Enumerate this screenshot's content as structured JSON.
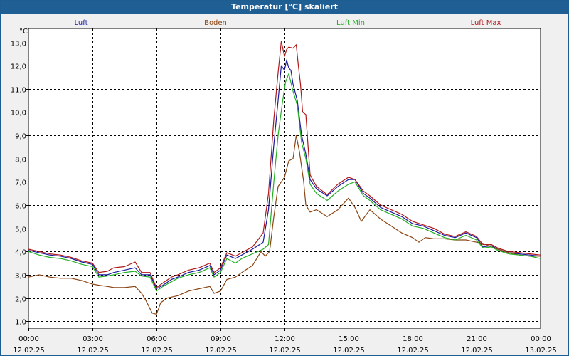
{
  "window": {
    "title": "Temperatur [°C] skaliert"
  },
  "colors": {
    "background": "#f0f0f0",
    "titlebar": "#1f5f94",
    "plot_background": "#ffffff",
    "grid": "#000000"
  },
  "chart_data": {
    "type": "line",
    "title": "Temperatur [°C] skaliert",
    "ylabel": "°C",
    "xlabel": "",
    "ylim": [
      0.7,
      13.6
    ],
    "xlim": [
      0,
      24
    ],
    "grid": true,
    "legend_placement": "top",
    "y_ticks": [
      "1,0",
      "2,0",
      "3,0",
      "4,0",
      "5,0",
      "6,0",
      "7,0",
      "8,0",
      "9,0",
      "10,0",
      "11,0",
      "12,0",
      "13,0"
    ],
    "x_ticks": [
      {
        "time": "00:00",
        "date": "12.02.25"
      },
      {
        "time": "03:00",
        "date": "12.02.25"
      },
      {
        "time": "06:00",
        "date": "12.02.25"
      },
      {
        "time": "09:00",
        "date": "12.02.25"
      },
      {
        "time": "12:00",
        "date": "12.02.25"
      },
      {
        "time": "15:00",
        "date": "12.02.25"
      },
      {
        "time": "18:00",
        "date": "12.02.25"
      },
      {
        "time": "21:00",
        "date": "12.02.25"
      },
      {
        "time": "00:00",
        "date": "13.02.25"
      }
    ],
    "series": [
      {
        "name": "Luft",
        "color": "#1a1aa0",
        "points": [
          [
            0,
            4.05
          ],
          [
            0.5,
            3.95
          ],
          [
            1,
            3.85
          ],
          [
            1.5,
            3.8
          ],
          [
            2,
            3.7
          ],
          [
            2.5,
            3.55
          ],
          [
            3,
            3.45
          ],
          [
            3.3,
            3.0
          ],
          [
            3.7,
            3.0
          ],
          [
            4,
            3.1
          ],
          [
            4.5,
            3.2
          ],
          [
            5,
            3.3
          ],
          [
            5.3,
            3.0
          ],
          [
            5.7,
            3.0
          ],
          [
            6,
            2.4
          ],
          [
            6.3,
            2.55
          ],
          [
            6.7,
            2.8
          ],
          [
            7,
            2.9
          ],
          [
            7.5,
            3.1
          ],
          [
            8,
            3.2
          ],
          [
            8.5,
            3.4
          ],
          [
            8.7,
            3.0
          ],
          [
            9,
            3.2
          ],
          [
            9.3,
            3.85
          ],
          [
            9.7,
            3.7
          ],
          [
            10,
            3.85
          ],
          [
            10.5,
            4.1
          ],
          [
            11,
            4.4
          ],
          [
            11.25,
            5.8
          ],
          [
            11.5,
            8.6
          ],
          [
            11.7,
            10.5
          ],
          [
            11.85,
            12.0
          ],
          [
            12,
            11.8
          ],
          [
            12.1,
            12.25
          ],
          [
            12.2,
            11.9
          ],
          [
            12.3,
            11.8
          ],
          [
            12.4,
            11.2
          ],
          [
            12.6,
            10.5
          ],
          [
            12.8,
            9.0
          ],
          [
            13,
            8.2
          ],
          [
            13.2,
            7.1
          ],
          [
            13.5,
            6.7
          ],
          [
            14,
            6.4
          ],
          [
            14.5,
            6.8
          ],
          [
            15,
            7.1
          ],
          [
            15.3,
            7.1
          ],
          [
            15.7,
            6.5
          ],
          [
            16,
            6.3
          ],
          [
            16.5,
            5.9
          ],
          [
            17,
            5.7
          ],
          [
            17.5,
            5.5
          ],
          [
            18,
            5.2
          ],
          [
            18.5,
            5.1
          ],
          [
            19,
            4.9
          ],
          [
            19.5,
            4.7
          ],
          [
            20,
            4.6
          ],
          [
            20.5,
            4.8
          ],
          [
            21,
            4.6
          ],
          [
            21.3,
            4.2
          ],
          [
            21.7,
            4.25
          ],
          [
            22,
            4.1
          ],
          [
            22.5,
            3.95
          ],
          [
            23,
            3.9
          ],
          [
            23.5,
            3.85
          ],
          [
            24,
            3.8
          ]
        ]
      },
      {
        "name": "Boden",
        "color": "#8b4513",
        "points": [
          [
            0,
            2.9
          ],
          [
            0.5,
            3.0
          ],
          [
            1,
            2.9
          ],
          [
            1.5,
            2.85
          ],
          [
            2,
            2.85
          ],
          [
            2.5,
            2.75
          ],
          [
            3,
            2.6
          ],
          [
            3.3,
            2.55
          ],
          [
            3.7,
            2.5
          ],
          [
            4,
            2.45
          ],
          [
            4.5,
            2.45
          ],
          [
            5,
            2.5
          ],
          [
            5.3,
            2.2
          ],
          [
            5.5,
            1.9
          ],
          [
            5.8,
            1.35
          ],
          [
            6,
            1.3
          ],
          [
            6.2,
            1.8
          ],
          [
            6.5,
            2.0
          ],
          [
            7,
            2.1
          ],
          [
            7.5,
            2.3
          ],
          [
            8,
            2.4
          ],
          [
            8.5,
            2.5
          ],
          [
            8.7,
            2.2
          ],
          [
            9,
            2.3
          ],
          [
            9.3,
            2.8
          ],
          [
            9.7,
            2.9
          ],
          [
            10,
            3.1
          ],
          [
            10.5,
            3.4
          ],
          [
            10.9,
            4.0
          ],
          [
            11.1,
            3.8
          ],
          [
            11.3,
            4.0
          ],
          [
            11.5,
            5.5
          ],
          [
            11.7,
            6.8
          ],
          [
            12,
            7.2
          ],
          [
            12.2,
            7.9
          ],
          [
            12.4,
            8.0
          ],
          [
            12.55,
            9.0
          ],
          [
            12.7,
            8.3
          ],
          [
            12.9,
            7.0
          ],
          [
            13,
            6.0
          ],
          [
            13.2,
            5.7
          ],
          [
            13.5,
            5.8
          ],
          [
            14,
            5.5
          ],
          [
            14.5,
            5.8
          ],
          [
            15,
            6.3
          ],
          [
            15.3,
            5.9
          ],
          [
            15.6,
            5.3
          ],
          [
            16,
            5.8
          ],
          [
            16.5,
            5.4
          ],
          [
            17,
            5.1
          ],
          [
            17.5,
            4.8
          ],
          [
            18,
            4.6
          ],
          [
            18.3,
            4.4
          ],
          [
            18.6,
            4.6
          ],
          [
            19,
            4.55
          ],
          [
            19.5,
            4.55
          ],
          [
            20,
            4.5
          ],
          [
            20.5,
            4.5
          ],
          [
            21,
            4.4
          ],
          [
            21.3,
            4.35
          ],
          [
            21.7,
            4.2
          ],
          [
            22,
            4.1
          ],
          [
            22.5,
            3.95
          ],
          [
            23,
            3.85
          ],
          [
            23.5,
            3.8
          ],
          [
            24,
            3.8
          ]
        ]
      },
      {
        "name": "Luft Min",
        "color": "#22b022",
        "points": [
          [
            0,
            4.0
          ],
          [
            0.5,
            3.85
          ],
          [
            1,
            3.75
          ],
          [
            1.5,
            3.7
          ],
          [
            2,
            3.6
          ],
          [
            2.5,
            3.45
          ],
          [
            3,
            3.35
          ],
          [
            3.3,
            2.9
          ],
          [
            3.7,
            2.95
          ],
          [
            4,
            3.0
          ],
          [
            4.5,
            3.1
          ],
          [
            5,
            3.15
          ],
          [
            5.3,
            2.95
          ],
          [
            5.7,
            2.9
          ],
          [
            6,
            2.3
          ],
          [
            6.3,
            2.5
          ],
          [
            6.7,
            2.7
          ],
          [
            7,
            2.85
          ],
          [
            7.5,
            3.0
          ],
          [
            8,
            3.1
          ],
          [
            8.5,
            3.3
          ],
          [
            8.7,
            2.9
          ],
          [
            9,
            3.1
          ],
          [
            9.3,
            3.7
          ],
          [
            9.7,
            3.5
          ],
          [
            10,
            3.7
          ],
          [
            10.5,
            3.9
          ],
          [
            11,
            4.1
          ],
          [
            11.25,
            4.3
          ],
          [
            11.5,
            7.0
          ],
          [
            11.7,
            9.0
          ],
          [
            11.9,
            10.4
          ],
          [
            12.05,
            11.3
          ],
          [
            12.2,
            11.65
          ],
          [
            12.4,
            10.9
          ],
          [
            12.6,
            10.3
          ],
          [
            12.8,
            8.7
          ],
          [
            13,
            8.0
          ],
          [
            13.2,
            6.9
          ],
          [
            13.5,
            6.5
          ],
          [
            14,
            6.2
          ],
          [
            14.5,
            6.6
          ],
          [
            15,
            6.9
          ],
          [
            15.3,
            7.0
          ],
          [
            15.7,
            6.4
          ],
          [
            16,
            6.2
          ],
          [
            16.5,
            5.8
          ],
          [
            17,
            5.6
          ],
          [
            17.5,
            5.4
          ],
          [
            18,
            5.1
          ],
          [
            18.5,
            5.0
          ],
          [
            19,
            4.8
          ],
          [
            19.5,
            4.6
          ],
          [
            20,
            4.5
          ],
          [
            20.5,
            4.7
          ],
          [
            21,
            4.5
          ],
          [
            21.3,
            4.15
          ],
          [
            21.7,
            4.2
          ],
          [
            22,
            4.05
          ],
          [
            22.5,
            3.9
          ],
          [
            23,
            3.85
          ],
          [
            23.5,
            3.8
          ],
          [
            24,
            3.7
          ]
        ]
      },
      {
        "name": "Luft Max",
        "color": "#b01818",
        "points": [
          [
            0,
            4.1
          ],
          [
            0.5,
            4.0
          ],
          [
            1,
            3.9
          ],
          [
            1.5,
            3.85
          ],
          [
            2,
            3.75
          ],
          [
            2.5,
            3.6
          ],
          [
            3,
            3.5
          ],
          [
            3.3,
            3.1
          ],
          [
            3.7,
            3.15
          ],
          [
            4,
            3.3
          ],
          [
            4.5,
            3.35
          ],
          [
            5,
            3.55
          ],
          [
            5.3,
            3.1
          ],
          [
            5.7,
            3.1
          ],
          [
            6,
            2.45
          ],
          [
            6.3,
            2.65
          ],
          [
            6.7,
            2.9
          ],
          [
            7,
            3.0
          ],
          [
            7.5,
            3.2
          ],
          [
            8,
            3.3
          ],
          [
            8.5,
            3.5
          ],
          [
            8.7,
            3.1
          ],
          [
            9,
            3.3
          ],
          [
            9.3,
            3.95
          ],
          [
            9.7,
            3.8
          ],
          [
            10,
            3.95
          ],
          [
            10.5,
            4.2
          ],
          [
            11,
            4.8
          ],
          [
            11.25,
            6.5
          ],
          [
            11.5,
            9.7
          ],
          [
            11.7,
            11.7
          ],
          [
            11.85,
            13.05
          ],
          [
            12,
            12.4
          ],
          [
            12.1,
            12.7
          ],
          [
            12.2,
            12.8
          ],
          [
            12.4,
            12.75
          ],
          [
            12.55,
            12.9
          ],
          [
            12.65,
            12.0
          ],
          [
            12.75,
            11.2
          ],
          [
            12.85,
            10.0
          ],
          [
            13,
            9.9
          ],
          [
            13.2,
            7.3
          ],
          [
            13.5,
            6.8
          ],
          [
            14,
            6.45
          ],
          [
            14.5,
            6.9
          ],
          [
            15,
            7.2
          ],
          [
            15.3,
            7.1
          ],
          [
            15.7,
            6.6
          ],
          [
            16,
            6.4
          ],
          [
            16.5,
            6.0
          ],
          [
            17,
            5.8
          ],
          [
            17.5,
            5.6
          ],
          [
            18,
            5.3
          ],
          [
            18.5,
            5.15
          ],
          [
            19,
            5.0
          ],
          [
            19.5,
            4.75
          ],
          [
            20,
            4.65
          ],
          [
            20.5,
            4.85
          ],
          [
            21,
            4.65
          ],
          [
            21.3,
            4.3
          ],
          [
            21.7,
            4.3
          ],
          [
            22,
            4.15
          ],
          [
            22.5,
            4.0
          ],
          [
            23,
            3.95
          ],
          [
            23.5,
            3.9
          ],
          [
            24,
            3.85
          ]
        ]
      }
    ]
  }
}
